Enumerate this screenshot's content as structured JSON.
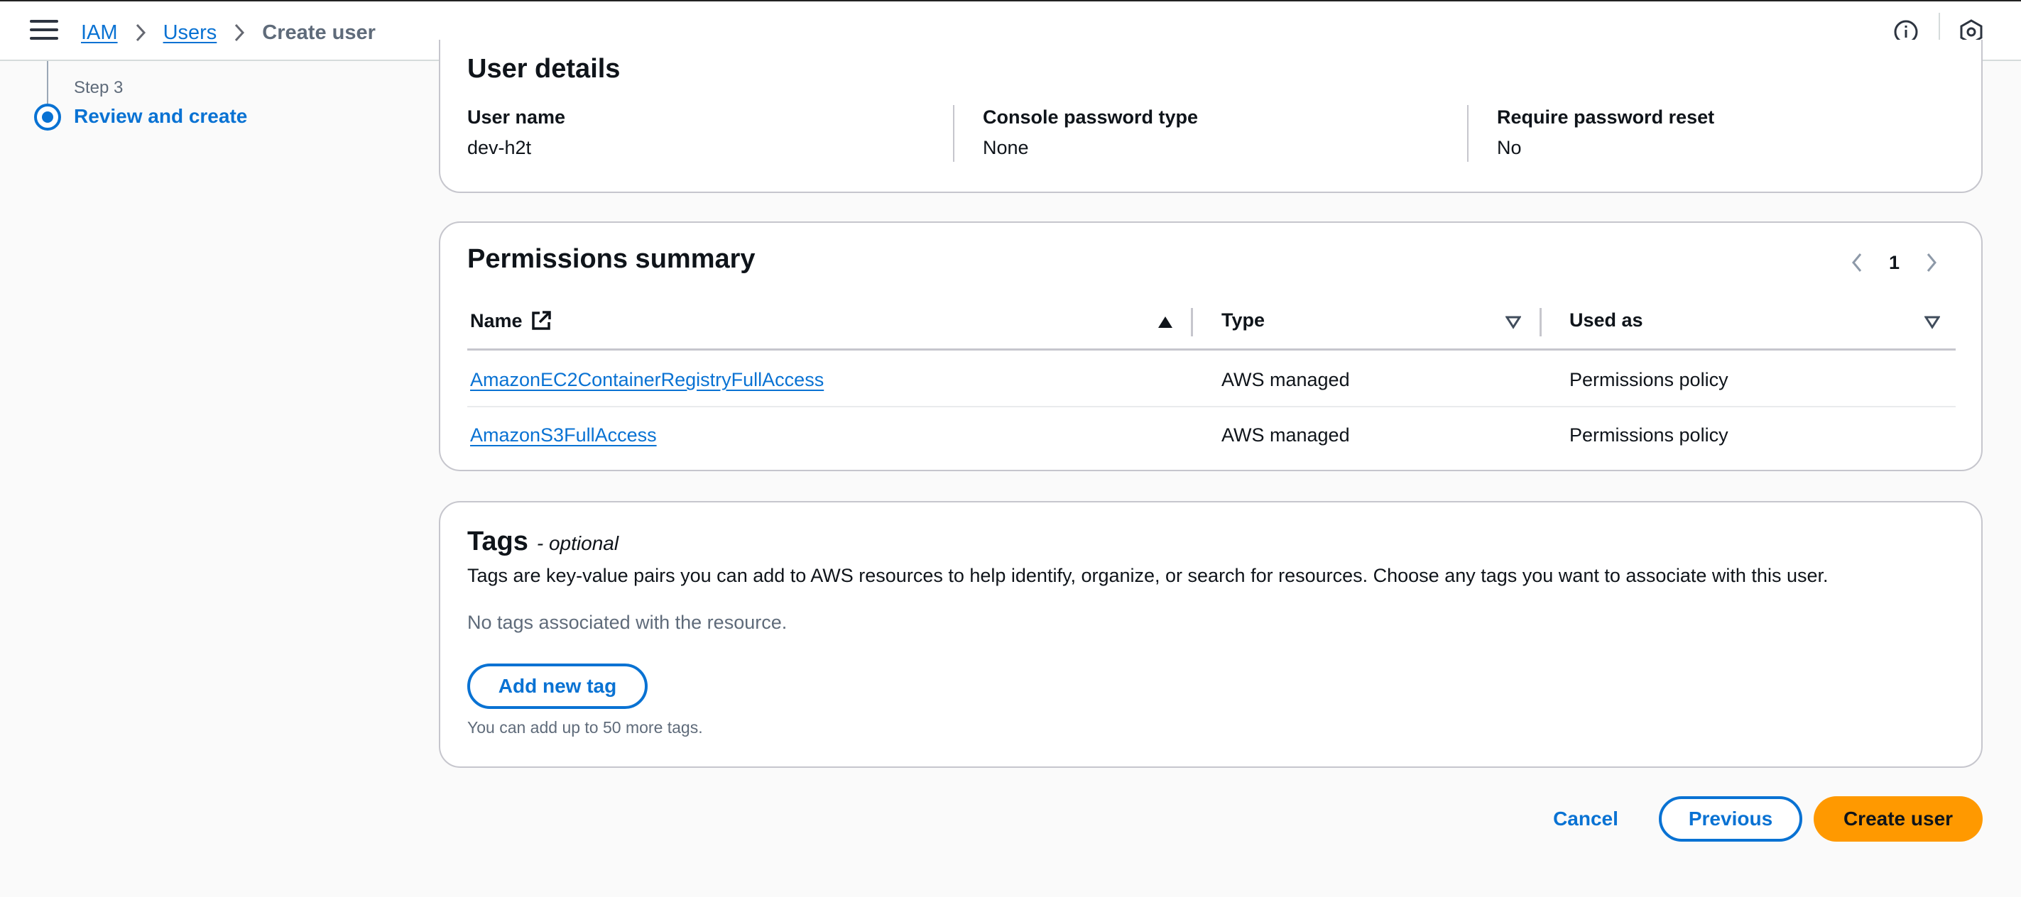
{
  "breadcrumbs": [
    {
      "label": "IAM"
    },
    {
      "label": "Users"
    },
    {
      "label": "Create user"
    }
  ],
  "step_nav": {
    "step_label": "Step 3",
    "step_title": "Review and create"
  },
  "user_details": {
    "title": "User details",
    "fields": [
      {
        "key": "User name",
        "value": "dev-h2t"
      },
      {
        "key": "Console password type",
        "value": "None"
      },
      {
        "key": "Require password reset",
        "value": "No"
      }
    ]
  },
  "permissions": {
    "title": "Permissions summary",
    "page": "1",
    "columns": [
      "Name",
      "Type",
      "Used as"
    ],
    "rows": [
      {
        "name": "AmazonEC2ContainerRegistryFullAccess",
        "type": "AWS managed",
        "used_as": "Permissions policy"
      },
      {
        "name": "AmazonS3FullAccess",
        "type": "AWS managed",
        "used_as": "Permissions policy"
      }
    ]
  },
  "tags": {
    "title": "Tags",
    "optional": "- optional",
    "description": "Tags are key-value pairs you can add to AWS resources to help identify, organize, or search for resources. Choose any tags you want to associate with this user.",
    "empty_text": "No tags associated with the resource.",
    "add_button": "Add new tag",
    "hint": "You can add up to 50 more tags."
  },
  "actions": {
    "cancel": "Cancel",
    "previous": "Previous",
    "create": "Create user"
  },
  "colors": {
    "link": "#0972d3",
    "primary_button": "#ff9900",
    "border": "#c6c6cd"
  },
  "icons": {
    "menu": "hamburger-menu-icon",
    "info": "info-icon",
    "settings": "hexagon-settings-icon",
    "external": "external-link-icon",
    "sort_asc": "sort-ascending-icon",
    "sort": "sort-descending-icon"
  }
}
